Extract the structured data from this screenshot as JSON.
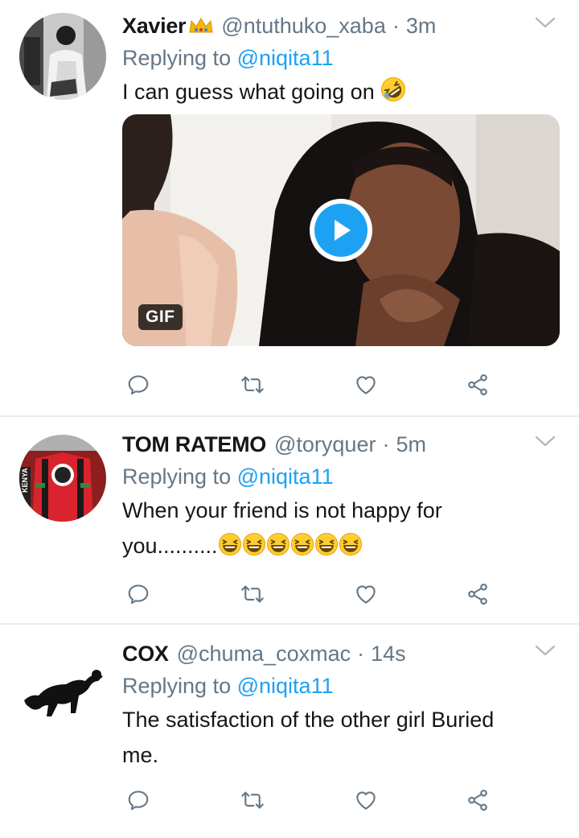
{
  "tweets": [
    {
      "name": "Xavier",
      "handle": "@ntuthuko_xaba",
      "separator": "·",
      "time": "3m",
      "reply_prefix": "Replying to",
      "reply_to": "@niqita11",
      "text": "I can guess what going on",
      "badge": "crown-emoji",
      "text_emoji": "rolling-on-floor-laughing-emoji",
      "media": {
        "type": "gif",
        "badge": "GIF",
        "control": "play-icon"
      }
    },
    {
      "name": "TOM RATEMO",
      "handle": "@toryquer",
      "separator": "·",
      "time": "5m",
      "reply_prefix": "Replying to",
      "reply_to": "@niqita11",
      "text_line1": "When your friend is not happy for",
      "text_line2": "you..........",
      "text_emoji": "grinning-squinting-face-emoji",
      "text_emoji_count": 6,
      "avatar_text": "KENYA"
    },
    {
      "name": "COX",
      "handle": "@chuma_coxmac",
      "separator": "·",
      "time": "14s",
      "reply_prefix": "Replying to",
      "reply_to": "@niqita11",
      "text_line1": "The satisfaction of the other girl Buried",
      "text_line2": "me."
    }
  ],
  "actions": [
    "reply-icon",
    "retweet-icon",
    "like-icon",
    "share-icon"
  ],
  "colors": {
    "accent": "#1da1f2",
    "muted": "#657786",
    "text": "#14171a",
    "divider": "#e6ecf0"
  }
}
